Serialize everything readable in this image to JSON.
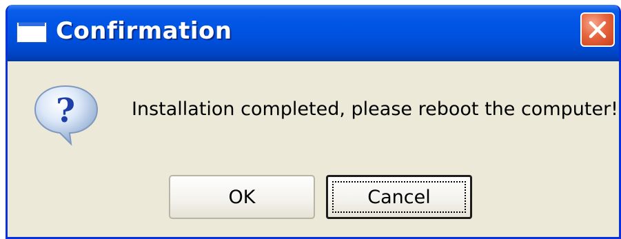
{
  "window": {
    "title": "Confirmation",
    "title_icon": "window-icon",
    "close_icon": "close-icon"
  },
  "dialog": {
    "icon": "question-icon",
    "message": "Installation completed, please reboot the computer!"
  },
  "buttons": {
    "ok_label": "OK",
    "cancel_label": "Cancel"
  },
  "colors": {
    "titlebar": "#0055e5",
    "client_background": "#ece9d8",
    "close_button": "#e6653f"
  }
}
